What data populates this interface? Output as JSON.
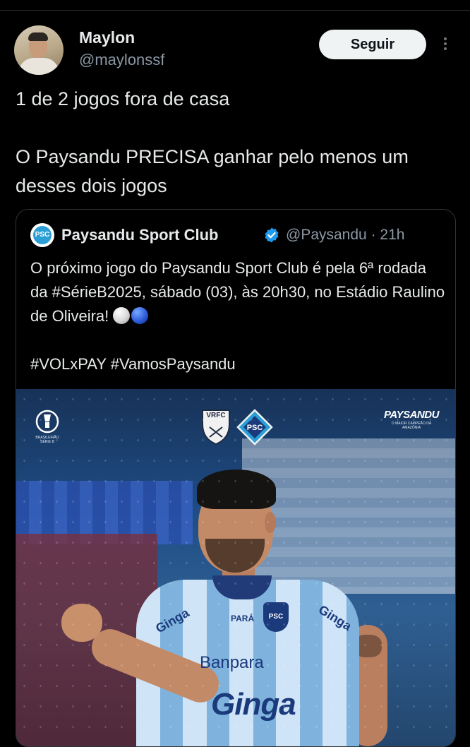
{
  "author": {
    "name": "Maylon",
    "handle": "@maylonssf",
    "follow_label": "Seguir"
  },
  "tweet": {
    "paragraphs": [
      "1 de 2 jogos fora de casa",
      "O Paysandu PRECISA ganhar pelo menos um desses dois jogos"
    ]
  },
  "quoted": {
    "avatar_text": "PSC",
    "name": "Paysandu Sport Club",
    "handle": "@Paysandu",
    "separator": "·",
    "time": "21h",
    "text_line1": "O próximo jogo do Paysandu Sport Club é pela 6ª rodada da #SérieB2025, sábado (03), às 20h30, no Estádio Raulino de Oliveira!",
    "hashtags": "#VOLxPAY #VamosPaysandu",
    "media": {
      "league_caption": "BRASILEIRÃO SÉRIE B",
      "home_crest": "VRFC",
      "away_crest": "PSC",
      "brand": "PAYSANDU",
      "brand_caption": "O MAIOR CAMPEÃO DA AMAZÔNIA",
      "sleeve_left": "Ginga",
      "sleeve_right": "Ginga",
      "chest_text": "PARÁ",
      "crest_text": "PSC",
      "sponsor": "Banpara",
      "sponsor_bottom": "Ginga"
    }
  },
  "colors": {
    "background": "#000000",
    "text": "#e7e9ea",
    "secondary_text": "#8b98a5",
    "verified": "#1d9bf0",
    "button_bg": "#eff3f4"
  }
}
